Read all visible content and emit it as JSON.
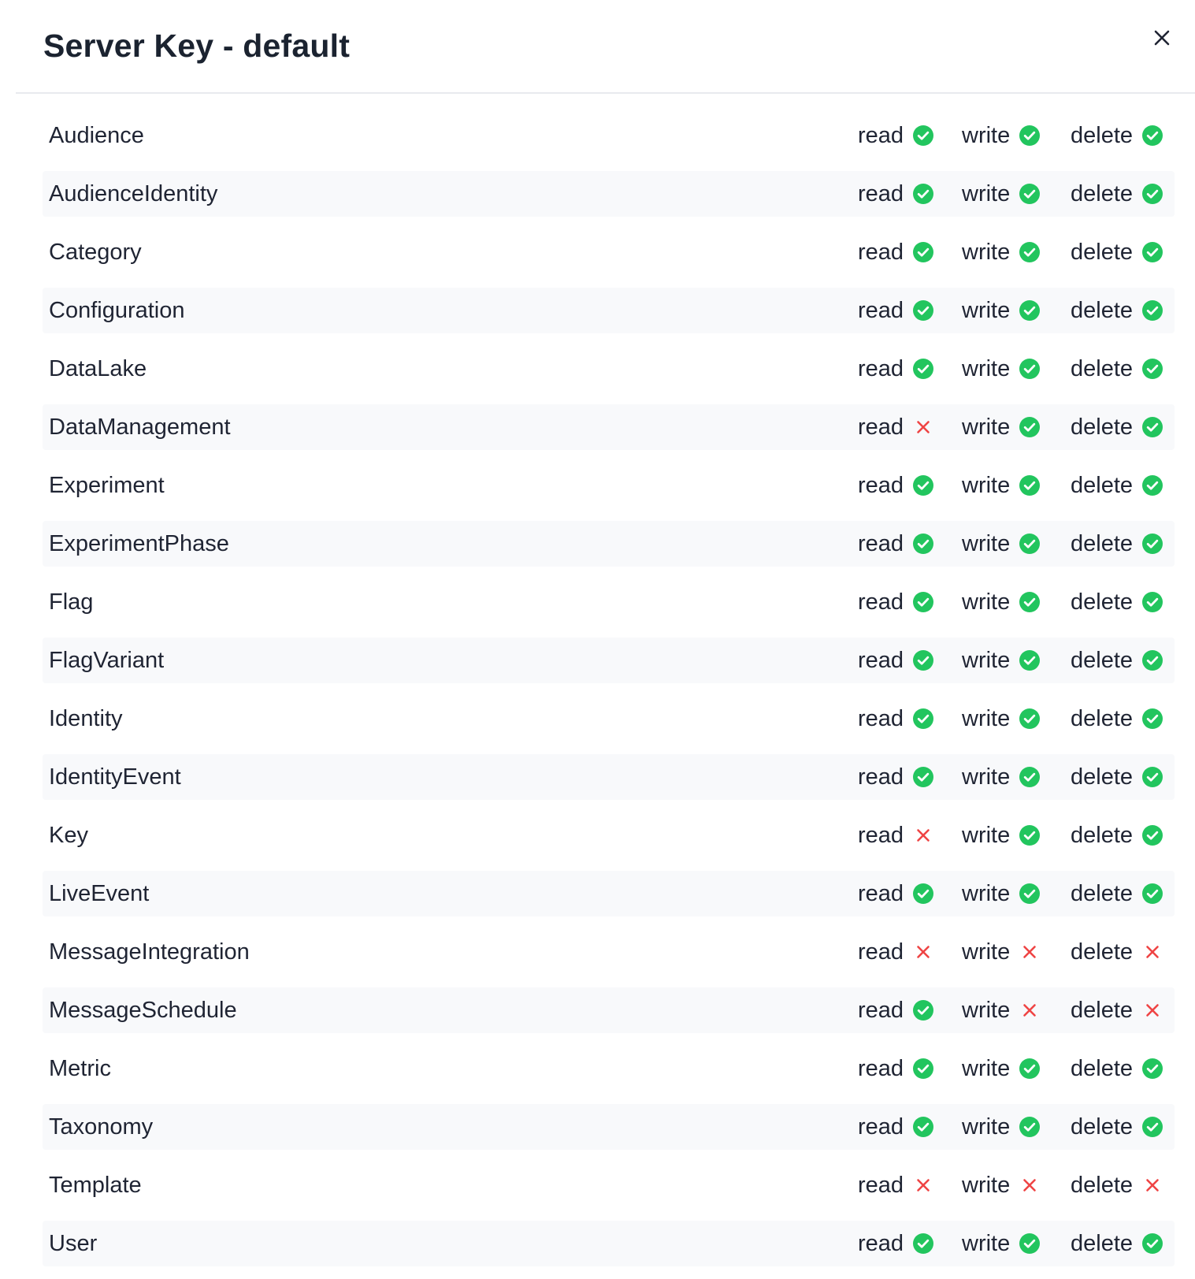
{
  "modal": {
    "title": "Server Key - default"
  },
  "labels": {
    "read": "read",
    "write": "write",
    "delete": "delete"
  },
  "colors": {
    "allowed": "#22c55e",
    "denied": "#ef4444"
  },
  "permissions": [
    {
      "name": "Audience",
      "read": true,
      "write": true,
      "delete": true
    },
    {
      "name": "AudienceIdentity",
      "read": true,
      "write": true,
      "delete": true
    },
    {
      "name": "Category",
      "read": true,
      "write": true,
      "delete": true
    },
    {
      "name": "Configuration",
      "read": true,
      "write": true,
      "delete": true
    },
    {
      "name": "DataLake",
      "read": true,
      "write": true,
      "delete": true
    },
    {
      "name": "DataManagement",
      "read": false,
      "write": true,
      "delete": true
    },
    {
      "name": "Experiment",
      "read": true,
      "write": true,
      "delete": true
    },
    {
      "name": "ExperimentPhase",
      "read": true,
      "write": true,
      "delete": true
    },
    {
      "name": "Flag",
      "read": true,
      "write": true,
      "delete": true
    },
    {
      "name": "FlagVariant",
      "read": true,
      "write": true,
      "delete": true
    },
    {
      "name": "Identity",
      "read": true,
      "write": true,
      "delete": true
    },
    {
      "name": "IdentityEvent",
      "read": true,
      "write": true,
      "delete": true
    },
    {
      "name": "Key",
      "read": false,
      "write": true,
      "delete": true
    },
    {
      "name": "LiveEvent",
      "read": true,
      "write": true,
      "delete": true
    },
    {
      "name": "MessageIntegration",
      "read": false,
      "write": false,
      "delete": false
    },
    {
      "name": "MessageSchedule",
      "read": true,
      "write": false,
      "delete": false
    },
    {
      "name": "Metric",
      "read": true,
      "write": true,
      "delete": true
    },
    {
      "name": "Taxonomy",
      "read": true,
      "write": true,
      "delete": true
    },
    {
      "name": "Template",
      "read": false,
      "write": false,
      "delete": false
    },
    {
      "name": "User",
      "read": true,
      "write": true,
      "delete": true
    }
  ]
}
